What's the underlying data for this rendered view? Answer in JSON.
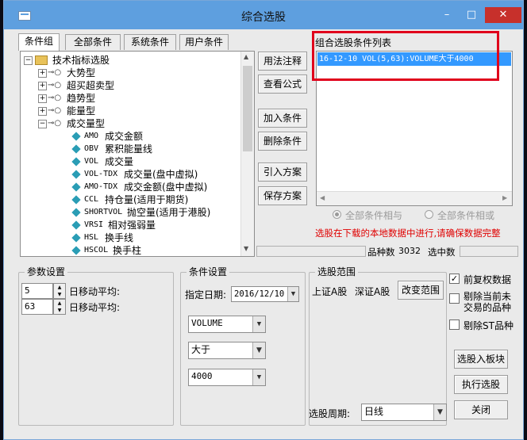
{
  "window": {
    "title": "综合选股",
    "buttons": {
      "minimize": "–",
      "maximize": "□",
      "close": "✕"
    }
  },
  "tabs": [
    "条件组",
    "全部条件",
    "系统条件",
    "用户条件"
  ],
  "tree": {
    "root": "技术指标选股",
    "groups": [
      "大势型",
      "超买超卖型",
      "趋势型",
      "能量型",
      "成交量型"
    ],
    "items": [
      {
        "code": "AMO",
        "name": "成交金额"
      },
      {
        "code": "OBV",
        "name": "累积能量线"
      },
      {
        "code": "VOL",
        "name": "成交量"
      },
      {
        "code": "VOL-TDX",
        "name": "成交量(盘中虚拟)"
      },
      {
        "code": "AMO-TDX",
        "name": "成交金额(盘中虚拟)"
      },
      {
        "code": "CCL",
        "name": "持仓量(适用于期货)"
      },
      {
        "code": "SHORTVOL",
        "name": "抛空量(适用于港股)"
      },
      {
        "code": "VRSI",
        "name": "相对强弱量"
      },
      {
        "code": "HSL",
        "name": "换手线"
      },
      {
        "code": "HSCOL",
        "name": "换手柱"
      }
    ]
  },
  "middle_buttons": [
    "用法注释",
    "查看公式",
    "加入条件",
    "删除条件",
    "引入方案",
    "保存方案"
  ],
  "cond_list": {
    "title": "组合选股条件列表",
    "items": [
      "16-12-10 VOL(5,63):VOLUME大于4000"
    ]
  },
  "logic": {
    "and_label": "全部条件相与",
    "or_label": "全部条件相或"
  },
  "notice": "选股在下载的本地数据中进行,请确保数据完整",
  "stats": {
    "count_label": "品种数",
    "count_value": "3032",
    "selected_label": "选中数",
    "selected_value": ""
  },
  "params": {
    "title": "参数设置",
    "rows": [
      {
        "value": "5",
        "label": "日移动平均:"
      },
      {
        "value": "63",
        "label": "日移动平均:"
      }
    ]
  },
  "cond_settings": {
    "title": "条件设置",
    "date_label": "指定日期:",
    "date_value": "2016/12/10",
    "field": "VOLUME",
    "op": "大于",
    "threshold": "4000"
  },
  "range": {
    "title": "选股范围",
    "items": [
      "上证A股",
      "深证A股"
    ],
    "change_button": "改变范围"
  },
  "period": {
    "label": "选股周期:",
    "value": "日线"
  },
  "options": [
    {
      "label": "前复权数据",
      "checked": true
    },
    {
      "label": "剔除当前未交易的品种",
      "checked": false
    },
    {
      "label": "剔除ST品种",
      "checked": false
    }
  ],
  "actions": {
    "add_to_board": "选股入板块",
    "execute": "执行选股",
    "close": "关闭"
  },
  "colors": {
    "titlebar": "#5e9fdf",
    "close": "#c7302b",
    "selection": "#3399ff",
    "notice": "#e00000",
    "highlight_box": "#e0001b"
  }
}
